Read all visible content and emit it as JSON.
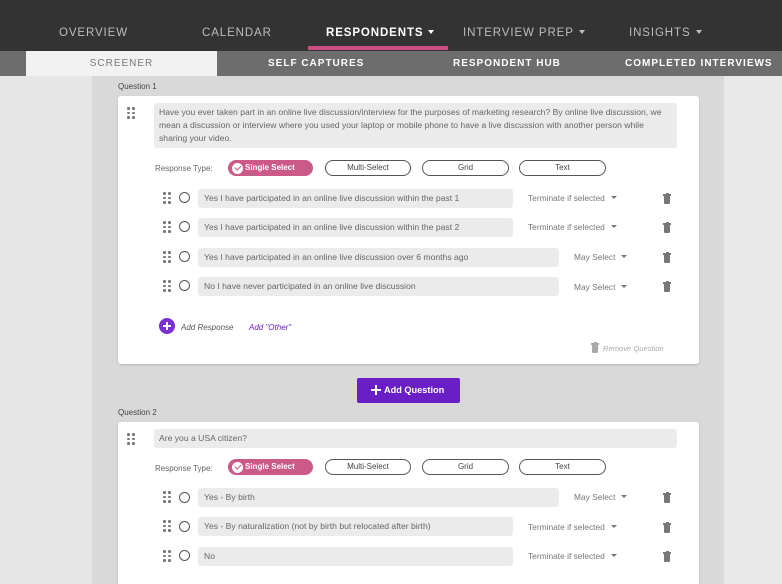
{
  "topnav": {
    "tabs": [
      {
        "label": "OVERVIEW",
        "dropdown": false
      },
      {
        "label": "CALENDAR",
        "dropdown": false
      },
      {
        "label": "RESPONDENTS",
        "dropdown": true,
        "active": true
      },
      {
        "label": "INTERVIEW PREP",
        "dropdown": true
      },
      {
        "label": "INSIGHTS",
        "dropdown": true
      }
    ]
  },
  "subnav": {
    "tabs": [
      {
        "label": "SCREENER",
        "active": true
      },
      {
        "label": "SELF CAPTURES"
      },
      {
        "label": "RESPONDENT HUB"
      },
      {
        "label": "COMPLETED INTERVIEWS"
      }
    ]
  },
  "colors": {
    "topnav_bg": "#333333",
    "active_underline": "#c94f82",
    "accent_purple": "#6a1fc6",
    "selected_pill": "#cc5a88"
  },
  "response_types": [
    "Single Select",
    "Multi-Select",
    "Grid",
    "Text"
  ],
  "questions": [
    {
      "label": "Question 1",
      "text": "Have you ever taken part in an online live discussion/interview for the purposes of marketing research?  By online live discussion, we mean a discussion or interview where you used your laptop or mobile phone to have a live discussion with another person while sharing your video.",
      "response_type_label": "Response Type:",
      "answers": [
        {
          "text": "Yes I have participated in an online live discussion within the past 1",
          "rule": "Terminate if selected"
        },
        {
          "text": "Yes I have participated in an online live discussion within the past 2",
          "rule": "Terminate if selected"
        },
        {
          "text": "Yes I have participated in an online live discussion over 6 months ago",
          "rule": "May Select"
        },
        {
          "text": "No I have never participated in an online live discussion",
          "rule": "May Select"
        }
      ],
      "add_response": "Add Response",
      "add_other": "Add \"Other\"",
      "remove_question": "Remove Question"
    },
    {
      "label": "Question 2",
      "text": "Are you a USA citizen?",
      "response_type_label": "Response Type:",
      "answers": [
        {
          "text": "Yes - By birth",
          "rule": "May Select"
        },
        {
          "text": "Yes - By naturalization (not by birth but relocated after birth)",
          "rule": "Terminate if selected"
        },
        {
          "text": "No",
          "rule": "Terminate if selected"
        }
      ]
    }
  ],
  "add_question_label": "Add Question",
  "icons": [
    "drag-handle-icon",
    "radio-icon",
    "trash-icon",
    "plus-icon",
    "check-icon",
    "caret-down-icon"
  ]
}
